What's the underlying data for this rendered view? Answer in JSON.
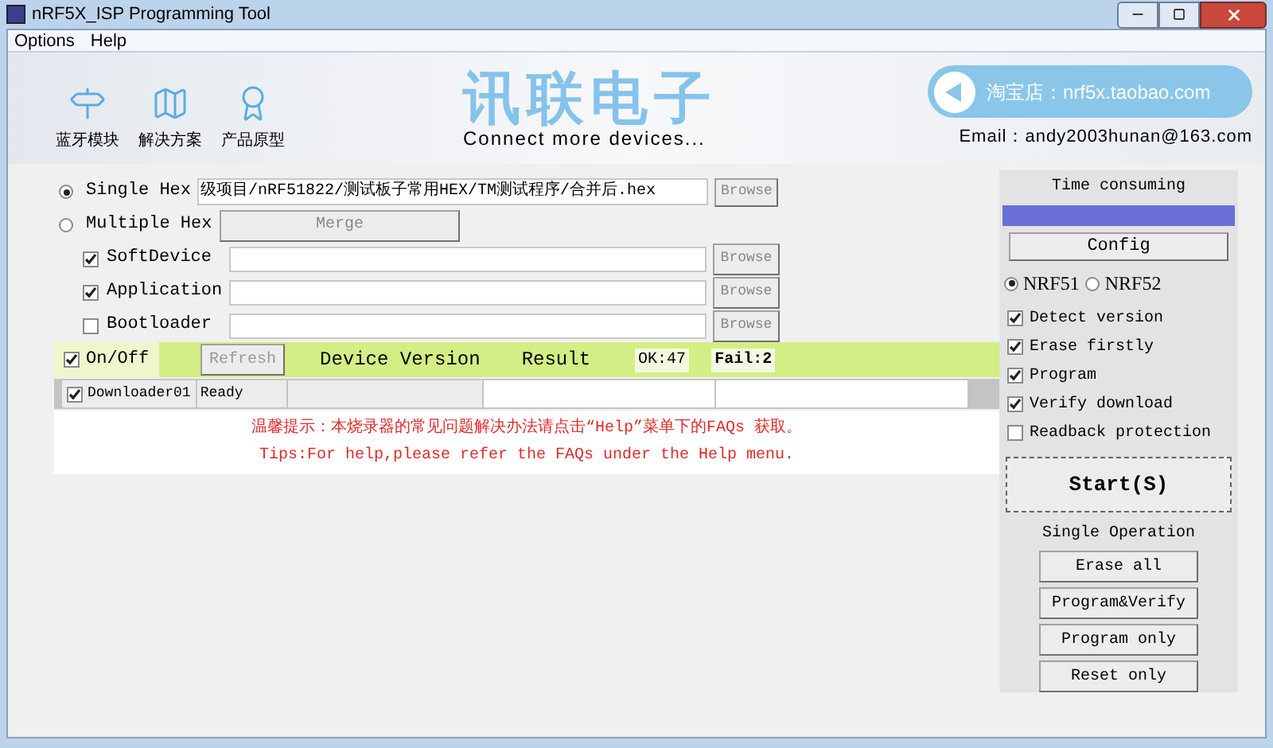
{
  "window": {
    "title": "nRF5X_ISP Programming Tool"
  },
  "menu": [
    {
      "label": "Options"
    },
    {
      "label": "Help"
    }
  ],
  "banner": {
    "nav": [
      {
        "label": "蓝牙模块",
        "kind": "signpost"
      },
      {
        "label": "解决方案",
        "kind": "map"
      },
      {
        "label": "产品原型",
        "kind": "award"
      }
    ],
    "brand": "讯联电子",
    "tagline": "Connect more devices...",
    "shop": "淘宝店：nrf5x.taobao.com",
    "email": "Email：andy2003hunan@163.com"
  },
  "source": {
    "modes": [
      {
        "label": "Single Hex",
        "selected": true
      },
      {
        "label": "Multiple Hex",
        "selected": false
      }
    ],
    "single_path": "级项目/nRF51822/测试板子常用HEX/TM测试程序/合并后.hex",
    "browse": "Browse",
    "merge": "Merge",
    "parts": [
      {
        "label": "SoftDevice",
        "checked": true,
        "browse": "Browse"
      },
      {
        "label": "Application",
        "checked": true,
        "browse": "Browse"
      },
      {
        "label": "Bootloader",
        "checked": false,
        "browse": "Browse"
      }
    ]
  },
  "result_bar": {
    "onoff": {
      "label": "On/Off",
      "checked": true
    },
    "refresh": "Refresh",
    "device_version": "Device Version",
    "result": "Result",
    "ok": "OK:47",
    "fail": "Fail:2"
  },
  "downloaders": [
    {
      "label": "Downloader01",
      "checked": true,
      "status": "Ready"
    }
  ],
  "tips": [
    "温馨提示：本烧录器的常见问题解决办法请点击“Help”菜单下的FAQs 获取。",
    "Tips:For help,please refer the FAQs under the Help menu."
  ],
  "side": {
    "time_label": "Time consuming",
    "config": "Config",
    "chips": [
      {
        "label": "NRF51",
        "selected": true
      },
      {
        "label": "NRF52",
        "selected": false
      }
    ],
    "options": [
      {
        "label": "Detect version",
        "checked": true
      },
      {
        "label": "Erase firstly",
        "checked": true
      },
      {
        "label": "Program",
        "checked": true
      },
      {
        "label": "Verify download",
        "checked": true
      },
      {
        "label": "Readback protection",
        "checked": false
      }
    ],
    "start": "Start(S)",
    "single_label": "Single Operation",
    "ops": [
      "Erase all",
      "Program&Verify",
      "Program only",
      "Reset only"
    ]
  }
}
